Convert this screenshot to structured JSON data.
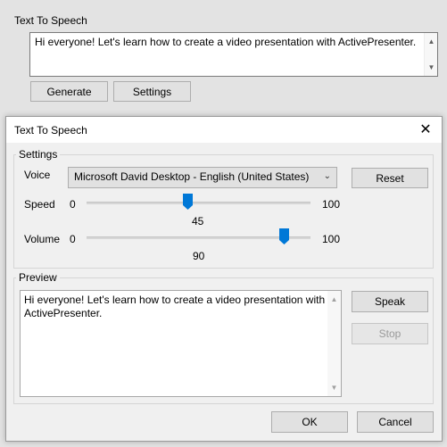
{
  "background": {
    "label": "Text To Speech",
    "text": "Hi everyone! Let's learn how to create a video presentation with ActivePresenter.",
    "generate_label": "Generate",
    "settings_label": "Settings"
  },
  "dialog": {
    "title": "Text To Speech",
    "close_glyph": "✕",
    "settings": {
      "group_label": "Settings",
      "voice_label": "Voice",
      "voice_value": "Microsoft David Desktop - English (United States)",
      "reset_label": "Reset",
      "speed": {
        "label": "Speed",
        "min_label": "0",
        "max_label": "100",
        "value": "45",
        "fraction": 0.45
      },
      "volume": {
        "label": "Volume",
        "min_label": "0",
        "max_label": "100",
        "value": "90",
        "fraction": 0.9
      }
    },
    "preview": {
      "group_label": "Preview",
      "text_line1": "Hi everyone! Let's learn how to create a video presentation with",
      "text_line2": "ActivePresenter.",
      "speak_label": "Speak",
      "stop_label": "Stop"
    },
    "ok_label": "OK",
    "cancel_label": "Cancel"
  },
  "colors": {
    "accent": "#0078d7",
    "dialog_bg": "#f0f0f0",
    "page_bg": "#e3e3e3"
  }
}
